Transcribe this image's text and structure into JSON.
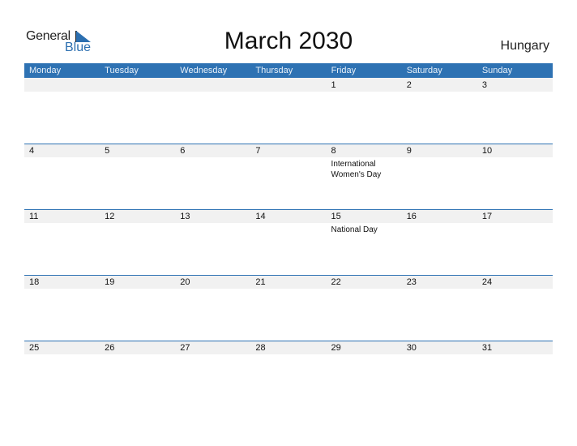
{
  "logo": {
    "line1": "General",
    "line2": "Blue"
  },
  "title": "March 2030",
  "country": "Hungary",
  "colors": {
    "accent": "#2e72b3",
    "row_bg": "#f1f1f1"
  },
  "weekdays": [
    "Monday",
    "Tuesday",
    "Wednesday",
    "Thursday",
    "Friday",
    "Saturday",
    "Sunday"
  ],
  "weeks": [
    [
      {
        "day": ""
      },
      {
        "day": ""
      },
      {
        "day": ""
      },
      {
        "day": ""
      },
      {
        "day": "1"
      },
      {
        "day": "2"
      },
      {
        "day": "3"
      }
    ],
    [
      {
        "day": "4"
      },
      {
        "day": "5"
      },
      {
        "day": "6"
      },
      {
        "day": "7"
      },
      {
        "day": "8",
        "event": "International Women's Day"
      },
      {
        "day": "9"
      },
      {
        "day": "10"
      }
    ],
    [
      {
        "day": "11"
      },
      {
        "day": "12"
      },
      {
        "day": "13"
      },
      {
        "day": "14"
      },
      {
        "day": "15",
        "event": "National Day"
      },
      {
        "day": "16"
      },
      {
        "day": "17"
      }
    ],
    [
      {
        "day": "18"
      },
      {
        "day": "19"
      },
      {
        "day": "20"
      },
      {
        "day": "21"
      },
      {
        "day": "22"
      },
      {
        "day": "23"
      },
      {
        "day": "24"
      }
    ],
    [
      {
        "day": "25"
      },
      {
        "day": "26"
      },
      {
        "day": "27"
      },
      {
        "day": "28"
      },
      {
        "day": "29"
      },
      {
        "day": "30"
      },
      {
        "day": "31"
      }
    ]
  ]
}
